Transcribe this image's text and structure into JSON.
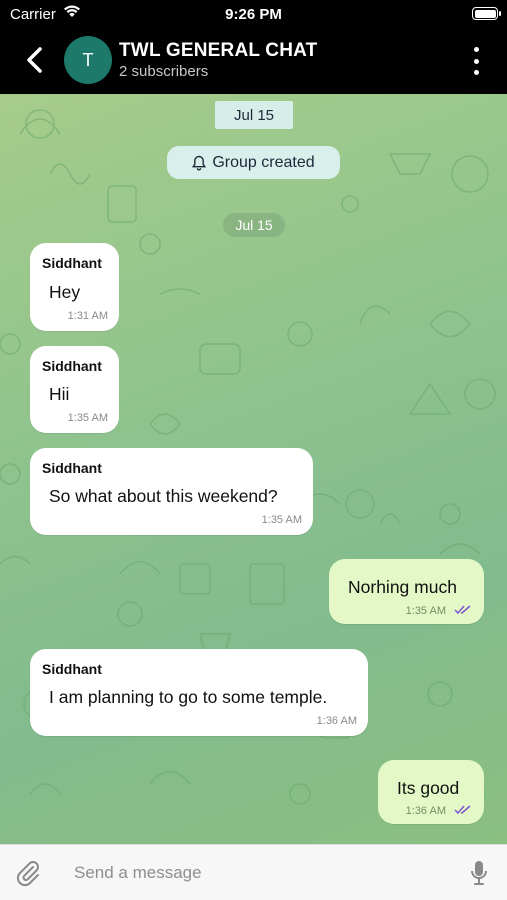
{
  "status_bar": {
    "carrier": "Carrier",
    "time": "9:26 PM"
  },
  "header": {
    "avatar_letter": "T",
    "title": "TWL GENERAL CHAT",
    "subtitle": "2 subscribers"
  },
  "chat": {
    "date_separator_1": "Jul 15",
    "service_message": "Group created",
    "date_separator_2": "Jul 15",
    "messages": [
      {
        "sender": "Siddhant",
        "text": "Hey",
        "time": "1:31 AM"
      },
      {
        "sender": "Siddhant",
        "text": "Hii",
        "time": "1:35 AM"
      },
      {
        "sender": "Siddhant",
        "text": "So what about this weekend?",
        "time": "1:35 AM"
      },
      {
        "sender": "",
        "text": "Norhing much",
        "time": "1:35 AM",
        "outgoing": true
      },
      {
        "sender": "Siddhant",
        "text": "I am planning to go to some temple.",
        "time": "1:36 AM"
      },
      {
        "sender": "",
        "text": "Its good",
        "time": "1:36 AM",
        "outgoing": true
      }
    ]
  },
  "composer": {
    "placeholder": "Send a message"
  },
  "colors": {
    "header_bg": "#000000",
    "avatar": "#1d7a6b",
    "outgoing_bubble": "#e3f8c6",
    "incoming_bubble": "#ffffff",
    "read_checks": "#7b57c9"
  }
}
